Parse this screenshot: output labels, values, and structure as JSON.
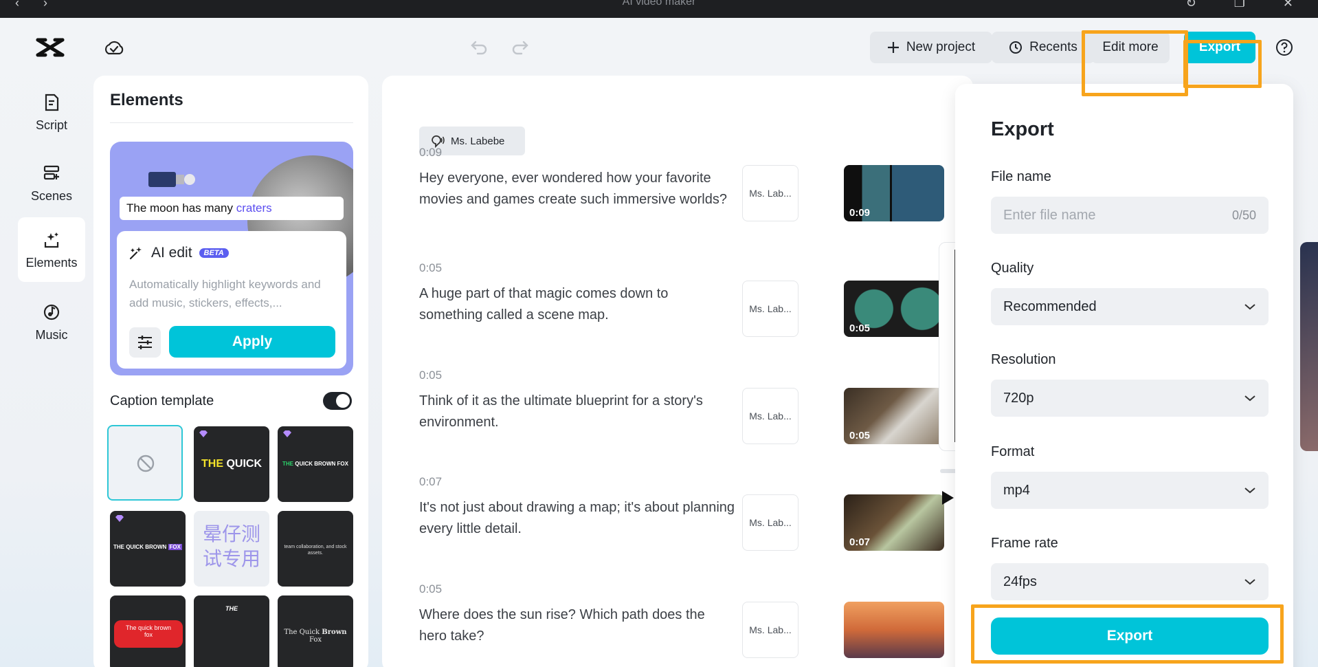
{
  "window": {
    "title": "AI video maker",
    "nav_back": "‹",
    "nav_forward": "›",
    "refresh_glyph": "↻",
    "restore_glyph": "❐",
    "close_glyph": "✕"
  },
  "toolbar": {
    "new_project": "New project",
    "recents": "Recents",
    "edit_more": "Edit more",
    "export": "Export"
  },
  "rail": {
    "items": [
      {
        "label": "Script",
        "icon": "script-icon"
      },
      {
        "label": "Scenes",
        "icon": "scenes-icon"
      },
      {
        "label": "Elements",
        "icon": "elements-icon",
        "active": true
      },
      {
        "label": "Music",
        "icon": "music-icon"
      }
    ]
  },
  "elements": {
    "title": "Elements",
    "preview_caption_prefix": "The moon has many ",
    "preview_caption_keyword": "craters",
    "ai_edit_title": "AI edit",
    "ai_edit_badge": "BETA",
    "ai_edit_desc": "Automatically highlight keywords and add music, stickers, effects,...",
    "apply": "Apply",
    "caption_template_label": "Caption template",
    "caption_template_enabled": true,
    "templates": {
      "t1_a": "THE ",
      "t1_b": "QUICK",
      "t2_a": "THE ",
      "t2_b": "QUICK BROWN FOX",
      "t3_a": "THE QUICK BROWN ",
      "t3_b": "FOX",
      "t4": "晕仔测试专用",
      "t5": "team collaboration, and stock assets.",
      "t6": "The quick brown fox",
      "t7": "THE",
      "t8_a": "The Quick ",
      "t8_b": "Brown",
      "t8_c": " Fox"
    }
  },
  "script": {
    "voice": "Ms. Labebe",
    "scenes": [
      {
        "time": "0:09",
        "text": "Hey everyone, ever wondered how your favorite movies and games create such immersive worlds?",
        "voice": "Ms. Lab...",
        "duration": "0:09"
      },
      {
        "time": "0:05",
        "text": "A huge part of that magic comes down to something called a scene map.",
        "voice": "Ms. Lab...",
        "duration": "0:05"
      },
      {
        "time": "0:05",
        "text": "Think of it as the ultimate blueprint for a story's environment.",
        "voice": "Ms. Lab...",
        "duration": "0:05"
      },
      {
        "time": "0:07",
        "text": "It's not just about drawing a map; it's about planning every little detail.",
        "voice": "Ms. Lab...",
        "duration": "0:07"
      },
      {
        "time": "0:05",
        "text": "Where does the sun rise? Which path does the hero take?",
        "voice": "Ms. Lab...",
        "duration": ""
      }
    ]
  },
  "export_panel": {
    "title": "Export",
    "file_name_label": "File name",
    "file_name_value": "",
    "file_name_placeholder": "Enter file name",
    "file_name_count": "0/50",
    "quality_label": "Quality",
    "quality_value": "Recommended",
    "resolution_label": "Resolution",
    "resolution_value": "720p",
    "format_label": "Format",
    "format_value": "mp4",
    "frame_rate_label": "Frame rate",
    "frame_rate_value": "24fps",
    "export_button": "Export"
  },
  "colors": {
    "accent": "#00c4d9",
    "highlight_box": "#f7a41c",
    "beta_badge": "#5b5ef0",
    "ai_card_bg": "#9aa2f4"
  }
}
